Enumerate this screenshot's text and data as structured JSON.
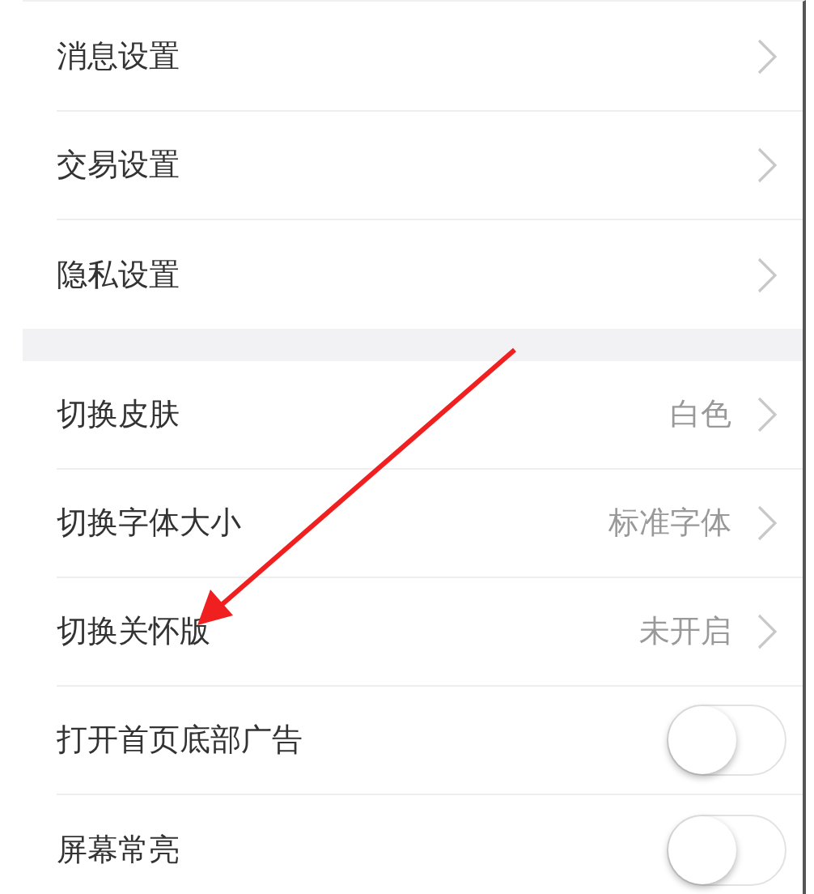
{
  "groups": [
    {
      "items": [
        {
          "kind": "link",
          "label": "消息设置"
        },
        {
          "kind": "link",
          "label": "交易设置"
        },
        {
          "kind": "link",
          "label": "隐私设置"
        }
      ]
    },
    {
      "items": [
        {
          "kind": "link",
          "label": "切换皮肤",
          "value": "白色"
        },
        {
          "kind": "link",
          "label": "切换字体大小",
          "value": "标准字体"
        },
        {
          "kind": "link",
          "label": "切换关怀版",
          "value": "未开启"
        },
        {
          "kind": "toggle",
          "label": "打开首页底部广告",
          "on": false
        },
        {
          "kind": "toggle",
          "label": "屏幕常亮",
          "on": false
        }
      ]
    }
  ]
}
